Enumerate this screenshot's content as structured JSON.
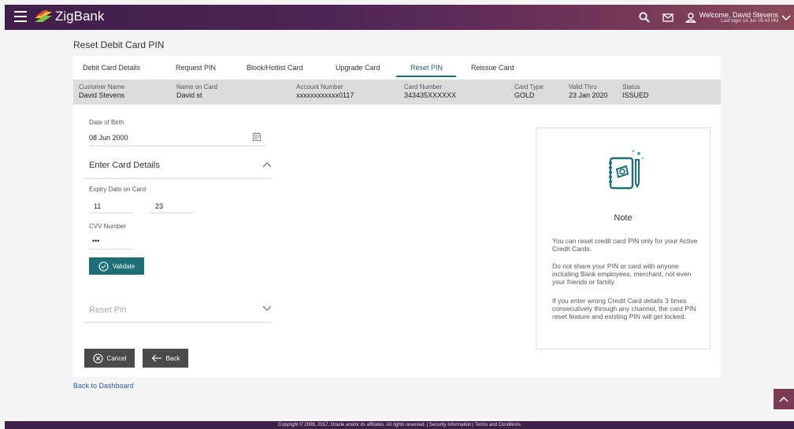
{
  "header": {
    "brand": "ZigBank",
    "welcome_name": "Welcome, David Stevens",
    "last_login": "Last login 14 Jun 05:43 PM",
    "icons": [
      "menu-icon",
      "search-icon",
      "mail-icon",
      "user-icon",
      "chevron-down-icon"
    ],
    "brand_color": "#4d2457"
  },
  "page": {
    "title": "Reset Debit Card PIN",
    "back_link": "Back to Dashboard"
  },
  "tabs": [
    {
      "label": "Debit Card Details",
      "active": false
    },
    {
      "label": "Request PIN",
      "active": false
    },
    {
      "label": "Block/Hotlist Card",
      "active": false
    },
    {
      "label": "Upgrade Card",
      "active": false
    },
    {
      "label": "Reset PIN",
      "active": true
    },
    {
      "label": "Reissue Card",
      "active": false
    }
  ],
  "card_info": {
    "customer_name": {
      "label": "Customer Name",
      "value": "David Stevens"
    },
    "name_on_card": {
      "label": "Name on Card",
      "value": "David st"
    },
    "account_number": {
      "label": "Account Number",
      "value": "xxxxxxxxxxxx0117"
    },
    "card_number": {
      "label": "Card Number",
      "value": "343435XXXXXX"
    },
    "card_type": {
      "label": "Card Type",
      "value": "GOLD"
    },
    "valid_thru": {
      "label": "Valid Thru",
      "value": "23 Jan 2020"
    },
    "status": {
      "label": "Status",
      "value": "ISSUED"
    }
  },
  "form": {
    "dob_label": "Date of Birth",
    "dob_value": "08 Jun 2000",
    "enter_card_details": "Enter Card Details",
    "expiry_label": "Expiry Date on Card",
    "expiry_month": "11",
    "expiry_year": "23",
    "cvv_label": "CVV Number",
    "cvv_value": "•••",
    "validate_label": "Validate",
    "reset_pin_title": "Reset Pin",
    "cancel_label": "Cancel",
    "back_label": "Back"
  },
  "note": {
    "title": "Note",
    "paragraphs": [
      "You can reset credit card PIN only for your Active Credit Cards.",
      "Do not share your PIN or card with anyone including Bank employees, merchant, not even your friends or family",
      "If you enter wrong Credit Card details 3 times consecutively through any channel, the card PIN reset feature and existing PIN will get locked."
    ]
  },
  "footer": {
    "text": "Copyright © 2006, 2017, Oracle and/or its affiliates. All rights reserved. | Security Information | Terms and Conditions"
  },
  "colors": {
    "accent": "#1c6f77",
    "button_dark": "#4a4a4a",
    "link": "#2a5f9e"
  }
}
